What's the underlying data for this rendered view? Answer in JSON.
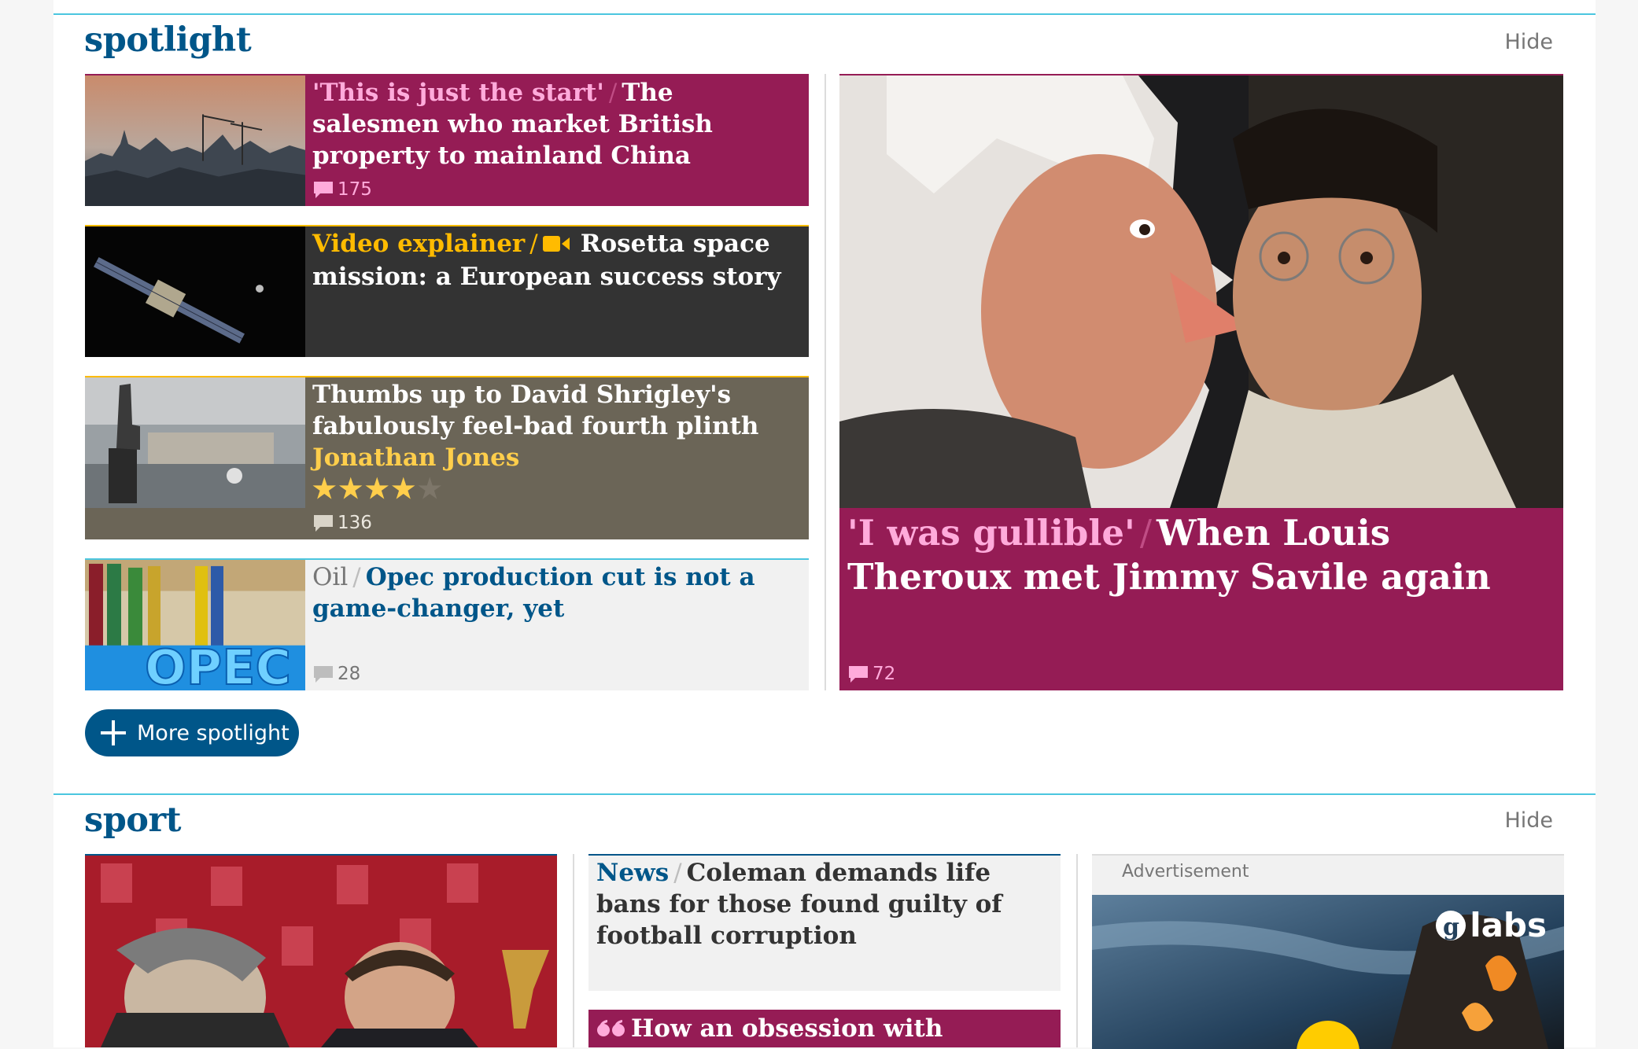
{
  "spotlight": {
    "title": "spotlight",
    "hide_label": "Hide",
    "more_label": "More spotlight",
    "cards": [
      {
        "kicker": "'This is just the start'",
        "headline": "The salesmen who market British property to mainland China",
        "comments": "175"
      },
      {
        "kicker": "Video explainer",
        "headline": "Rosetta space mission: a European success story",
        "icon": "video-camera-icon"
      },
      {
        "headline": "Thumbs up to David Shrigley's fabulously feel-bad fourth plinth",
        "byline": "Jonathan Jones",
        "rating": 4,
        "rating_max": 5,
        "comments": "136"
      },
      {
        "kicker": "Oil",
        "headline": "Opec production cut is not a game-changer, yet",
        "comments": "28",
        "image_text": "OPEC"
      }
    ],
    "feature": {
      "kicker": "'I was gullible'",
      "headline": "When Louis Theroux met Jimmy Savile again",
      "comments": "72"
    }
  },
  "sport": {
    "title": "sport",
    "hide_label": "Hide",
    "cards": [
      {
        "kicker": "News",
        "headline": "Coleman demands life bans for those found guilty of football corruption"
      },
      {
        "headline": "How an obsession with Football",
        "icon": "quote-icon"
      }
    ],
    "ad_label": "Advertisement",
    "ad_brand": "labs"
  },
  "colors": {
    "brand": "#005689",
    "rule": "#4bc6df",
    "feature": "#951c55",
    "kicker_pink": "#ffabdb",
    "video_bg": "#333333",
    "review_bg": "#6b6557",
    "review_accent": "#ffce4b",
    "light_card": "#f1f1f1"
  }
}
